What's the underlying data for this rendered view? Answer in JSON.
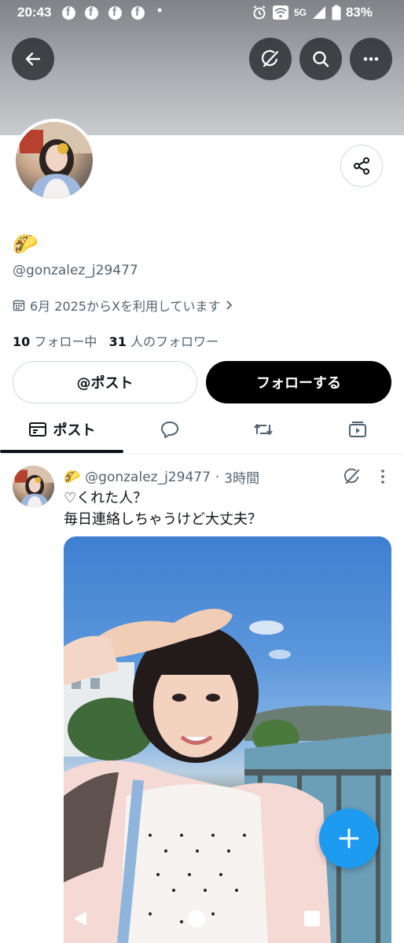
{
  "status_bar": {
    "time": "20:43",
    "network": "5G",
    "battery": "83%",
    "fb_glyph": "f",
    "dot": "•",
    "icons": [
      "facebook-icon",
      "facebook-icon",
      "facebook-icon",
      "facebook-icon",
      "alarm-icon",
      "wifi-icon",
      "signal-icon",
      "battery-icon"
    ]
  },
  "header": {
    "icons": [
      "back-arrow-icon",
      "grok-icon",
      "search-icon",
      "more-icon"
    ]
  },
  "profile": {
    "display_name": "🌮",
    "handle": "@gonzalez_j29477",
    "joined": "6月 2025からXを利用しています",
    "following_count": "10",
    "following_label": "フォロー中",
    "followers_count": "31",
    "followers_label": "人のフォロワー",
    "post_button": "@ポスト",
    "follow_button": "フォローする"
  },
  "tabs": [
    {
      "label": "ポスト",
      "icon": "posts-icon",
      "selected": true
    },
    {
      "label": "",
      "icon": "replies-icon",
      "selected": false
    },
    {
      "label": "",
      "icon": "repost-icon",
      "selected": false
    },
    {
      "label": "",
      "icon": "media-icon",
      "selected": false
    }
  ],
  "post": {
    "name": "🌮",
    "handle": "@gonzalez_j29477",
    "separator": "·",
    "time": "3時間",
    "text": "♡くれた人？\n毎日連絡しちゃうけど大丈夫？"
  },
  "colors": {
    "accent": "#1d9bf0",
    "text": "#0f1419",
    "secondary_text": "#536471",
    "follow_button": "#000000"
  }
}
